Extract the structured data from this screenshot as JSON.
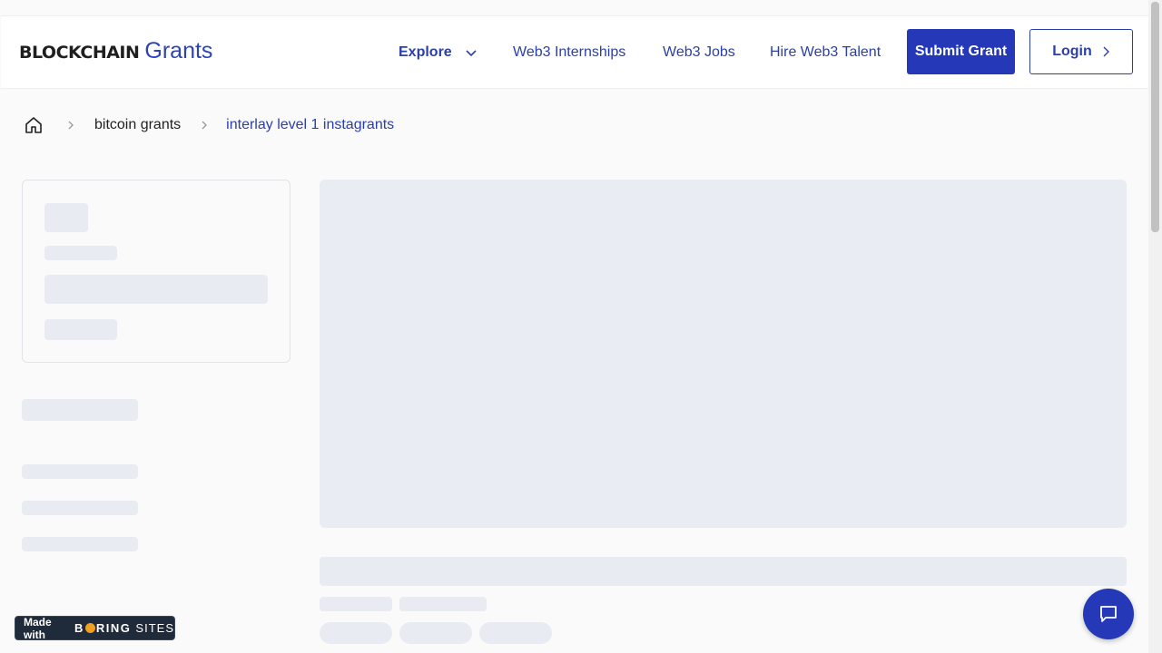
{
  "header": {
    "logo_bold": "BLOCKCHAIN",
    "logo_light": "Grants",
    "nav": {
      "explore": "Explore",
      "internships": "Web3 Internships",
      "jobs": "Web3 Jobs",
      "talent": "Hire Web3 Talent"
    },
    "submit_label": "Submit Grant",
    "login_label": "Login"
  },
  "breadcrumb": {
    "parent": "bitcoin grants",
    "current": "interlay level 1 instagrants"
  },
  "badge": {
    "made_with": "Made with",
    "brand_b": "B",
    "brand_rest": "RING",
    "brand_sites": "SITES"
  },
  "colors": {
    "accent": "#2438b8",
    "skeleton": "#e8ebf1"
  },
  "icons": [
    "chevron-down-icon",
    "home-icon",
    "chevron-right-icon",
    "chat-icon"
  ]
}
